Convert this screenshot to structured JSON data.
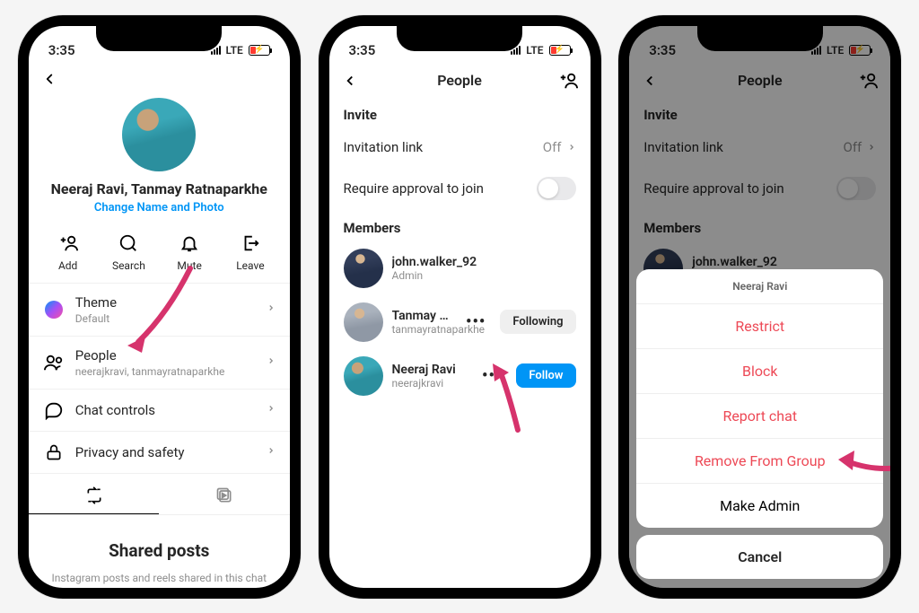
{
  "status": {
    "time": "3:35",
    "net": "LTE"
  },
  "phone1": {
    "group_name": "Neeraj Ravi, Tanmay Ratnaparkhe",
    "change_link": "Change Name and Photo",
    "actions": {
      "add": "Add",
      "search": "Search",
      "mute": "Mute",
      "leave": "Leave"
    },
    "rows": {
      "theme_title": "Theme",
      "theme_sub": "Default",
      "people_title": "People",
      "people_sub": "neerajkravi, tanmayratnaparkhe",
      "chat_controls": "Chat controls",
      "privacy": "Privacy and safety"
    },
    "empty": {
      "title": "Shared posts",
      "sub": "Instagram posts and reels shared in this chat will appear here."
    }
  },
  "phone2": {
    "title": "People",
    "invite_header": "Invite",
    "invitation_link": "Invitation link",
    "invitation_link_value": "Off",
    "require_approval": "Require approval to join",
    "members_header": "Members",
    "members": [
      {
        "name": "john.walker_92",
        "sub": "Admin",
        "button": "",
        "avatar": "av-bg3"
      },
      {
        "name": "Tanmay Ratnapar...",
        "sub": "tanmayratnaparkhe",
        "button": "Following",
        "avatar": "av-bg2"
      },
      {
        "name": "Neeraj Ravi",
        "sub": "neerajkravi",
        "button": "Follow",
        "avatar": "av-bg1"
      }
    ]
  },
  "phone3": {
    "sheet_title": "Neeraj Ravi",
    "restrict": "Restrict",
    "block": "Block",
    "report": "Report chat",
    "remove": "Remove From Group",
    "make_admin": "Make Admin",
    "cancel": "Cancel"
  }
}
